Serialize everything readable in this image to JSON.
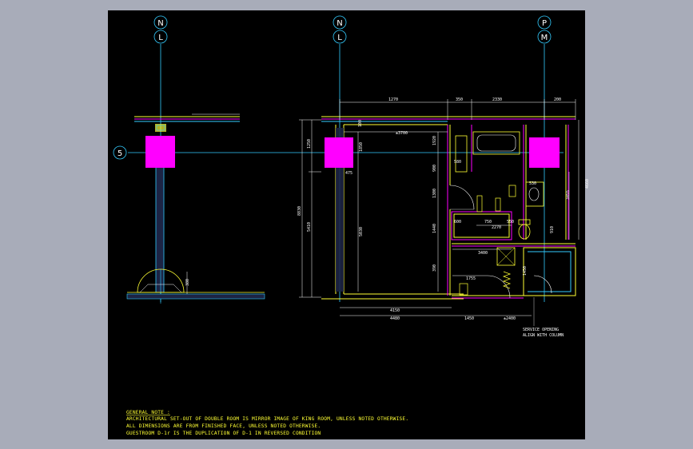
{
  "drawing": {
    "grid_labels": {
      "col1_top": "N",
      "col1_bottom": "L",
      "col2_top": "N",
      "col2_bottom": "L",
      "col3_top": "P",
      "col3_bottom": "M",
      "row": "5"
    },
    "dimensions": {
      "top_1270": "1270",
      "top_350": "350",
      "top_2330": "2330",
      "top_200": "200",
      "left_8830": "8830",
      "left_1250": "1250",
      "left_5410": "5410",
      "inner_1850": "1850",
      "inner_5030": "5030",
      "inner_3700": "±3700",
      "inner_475": "475",
      "inner_100": "100",
      "bottom_4150": "4150",
      "bottom_4480": "4480",
      "bottom_1450": "1450",
      "bottom_2400": "±2400",
      "bath_3400": "3400",
      "bath_1755": "1755",
      "bath_2270": "2270",
      "bath_1450": "1450",
      "right_4660": "4660",
      "right_3455": "3455",
      "small_580": "580",
      "small_530": "530",
      "small_750": "750",
      "small_550": "550",
      "small_600": "600",
      "small_1300": "1300",
      "small_1440": "1440",
      "small_900": "900",
      "small_1920": "1920",
      "small_390": "390",
      "small_910": "910",
      "small_380": "380"
    },
    "callout": {
      "line1": "SERVICE OPENING",
      "line2": "ALIGN WITH COLUMN"
    },
    "notes": {
      "heading": "GENERAL NOTE :",
      "line1": "ARCHITECTURAL SET-OUT OF DOUBLE ROOM IS MIRROR IMAGE OF KING ROOM, UNLESS NOTED OTHERWISE.",
      "line2": "ALL DIMENSIONS ARE FROM FINISHED FACE, UNLESS NOTED OTHERWISE.",
      "line3": "GUESTROOM D-1r IS THE DUPLICATION OF D-1 IN REVERSED CONDITION"
    },
    "colors": {
      "background": "#000000",
      "window_bg": "#a8acb9",
      "grid_line": "#33ccff",
      "column": "#ff00ff",
      "wall": "#ffff33",
      "dimension": "#ffffff",
      "fixture": "#ffff33",
      "partition": "#ff00ff"
    }
  }
}
